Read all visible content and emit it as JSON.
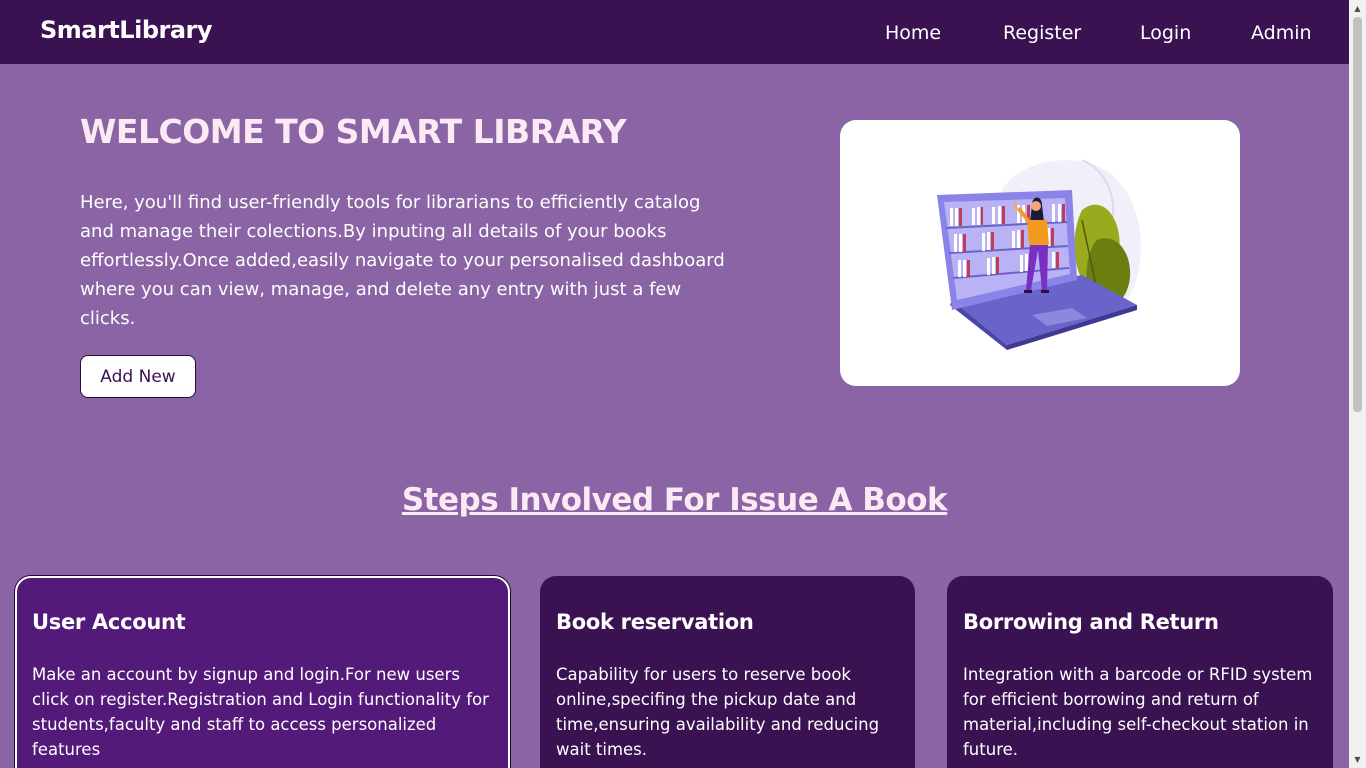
{
  "navbar": {
    "brand": "SmartLibrary",
    "links": [
      "Home",
      "Register",
      "Login",
      "Admin"
    ]
  },
  "hero": {
    "title": "WELCOME TO SMART LIBRARY",
    "text": "Here, you'll find user-friendly tools for librarians to efficiently catalog and manage their colections.By inputing all details of your books effortlessly.Once added,easily navigate to your personalised dashboard where you can view, manage, and delete any entry with just a few clicks.",
    "button_label": "Add New",
    "illustration": "woman-reading-bookshelf-laptop-illustration"
  },
  "steps": {
    "title": "Steps Involved For Issue A Book",
    "cards": [
      {
        "title": "User Account",
        "text": "Make an account by signup and login.For new users click on register.Registration and Login functionality for students,faculty and staff to access personalized features"
      },
      {
        "title": "Book reservation",
        "text": "Capability for users to reserve book online,specifing the pickup date and time,ensuring availability and reducing wait times."
      },
      {
        "title": "Borrowing and Return",
        "text": "Integration with a barcode or RFID system for efficient borrowing and return of material,including self-checkout station in future."
      }
    ]
  },
  "colors": {
    "page_background": "#8a64a4",
    "navbar_background": "#3a1252",
    "card_background": "#3a1252",
    "card_active_background": "#541a7a",
    "title_text": "#fbeaf3"
  }
}
